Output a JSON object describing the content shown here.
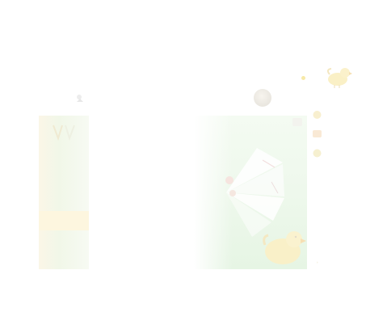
{
  "top_nav": {
    "item_1": "",
    "item_2": ""
  },
  "left": {
    "label": ""
  },
  "mid_row": {
    "label_1": "",
    "label_2": "",
    "avatar_label": ""
  },
  "sidebar": {
    "subtitle": "",
    "items": [
      {
        "title": "",
        "line_1": "",
        "line_2": ""
      },
      {
        "title": "",
        "line_1": "",
        "line_2": ""
      },
      {
        "title": "",
        "line_1": "",
        "line_2": ""
      }
    ],
    "more_link": ""
  },
  "colors": {
    "accent_yellow": "#f7e9a8",
    "game_green": "#eef8ec",
    "banner_cream": "#fbf6e7"
  }
}
